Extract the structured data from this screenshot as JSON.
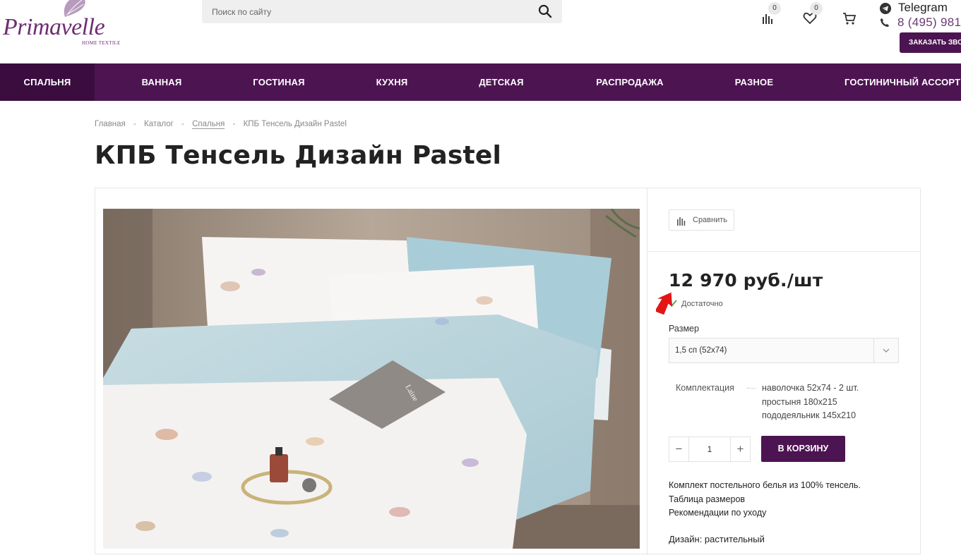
{
  "header": {
    "logo_text": "Primavelle",
    "logo_sub": "HOME TEXTILE",
    "search_placeholder": "Поиск по сайту",
    "compare_count": "0",
    "favorites_count": "0",
    "telegram_label": "Telegram",
    "phone": "8 (495) 981",
    "callback_label": "ЗАКАЗАТЬ ЗВОНОК"
  },
  "nav": {
    "items": [
      {
        "label": "СПАЛЬНЯ"
      },
      {
        "label": "ВАННАЯ"
      },
      {
        "label": "ГОСТИНАЯ"
      },
      {
        "label": "КУХНЯ"
      },
      {
        "label": "ДЕТСКАЯ"
      },
      {
        "label": "РАСПРОДАЖА"
      },
      {
        "label": "РАЗНОЕ"
      },
      {
        "label": "ГОСТИНИЧНЫЙ АССОРТИМЕНТ"
      }
    ]
  },
  "breadcrumb": [
    "Главная",
    "Каталог",
    "Спальня",
    "КПБ Тенсель Дизайн Pastel"
  ],
  "product": {
    "title": "КПБ Тенсель Дизайн Pastel",
    "compare_label": "Сравнить",
    "price": "12 970 руб./шт",
    "stock": "Достаточно",
    "size_label": "Размер",
    "size_value": "1,5 сп (52х74)",
    "spec_label": "Комплектация",
    "spec_lines": [
      "наволочка 52х74 - 2 шт.",
      "простыня 180х215",
      "пододеяльник 145х210"
    ],
    "quantity": "1",
    "add_to_cart": "В КОРЗИНУ",
    "description": "Комплект постельного белья из 100% тенсель.",
    "size_table_link": "Таблица размеров",
    "care_link": "Рекомендации по уходу",
    "design": "Дизайн: растительный",
    "book_label": "Laine"
  },
  "colors": {
    "brand": "#4d1452",
    "brand_dark": "#3a0d3e",
    "accent_text": "#6b3a73"
  }
}
